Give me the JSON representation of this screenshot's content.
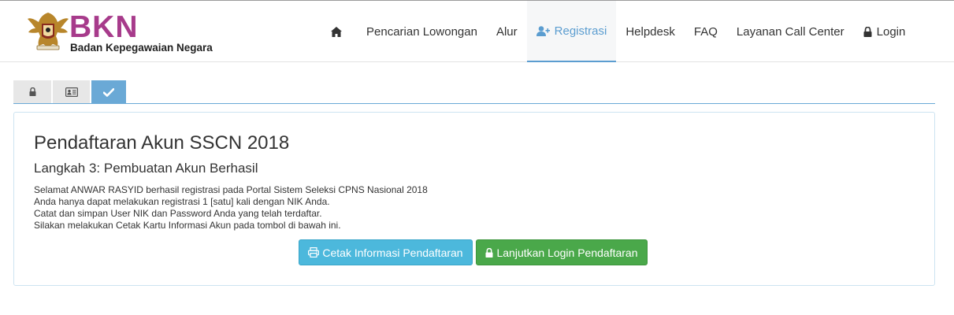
{
  "header": {
    "logo_text": "BKN",
    "logo_subtitle": "Badan Kepegawaian Negara",
    "nav": [
      {
        "label": "",
        "icon": "home-icon"
      },
      {
        "label": "Pencarian Lowongan"
      },
      {
        "label": "Alur"
      },
      {
        "label": "Registrasi",
        "icon": "user-plus-icon",
        "active": true
      },
      {
        "label": "Helpdesk"
      },
      {
        "label": "FAQ"
      },
      {
        "label": "Layanan Call Center"
      },
      {
        "label": "Login",
        "icon": "lock-icon"
      }
    ]
  },
  "steps": {
    "icons": [
      "lock-icon",
      "id-card-icon",
      "check-icon"
    ],
    "active_index": 2
  },
  "panel": {
    "title": "Pendaftaran Akun SSCN 2018",
    "subtitle": "Langkah 3: Pembuatan Akun Berhasil",
    "lines": [
      "Selamat ANWAR RASYID berhasil registrasi pada Portal Sistem Seleksi CPNS Nasional 2018",
      "Anda hanya dapat melakukan registrasi 1 [satu] kali dengan NIK Anda.",
      "Catat dan simpan User NIK dan Password Anda yang telah terdaftar.",
      "Silakan melakukan Cetak Kartu Informasi Akun pada tombol di bawah ini."
    ],
    "buttons": {
      "print_label": "Cetak Informasi Pendaftaran",
      "login_label": "Lanjutkan Login Pendaftaran"
    }
  },
  "colors": {
    "brand": "#a73b8b",
    "accent": "#5b9dd0",
    "info": "#4cb8dc",
    "success": "#4aa84a"
  }
}
